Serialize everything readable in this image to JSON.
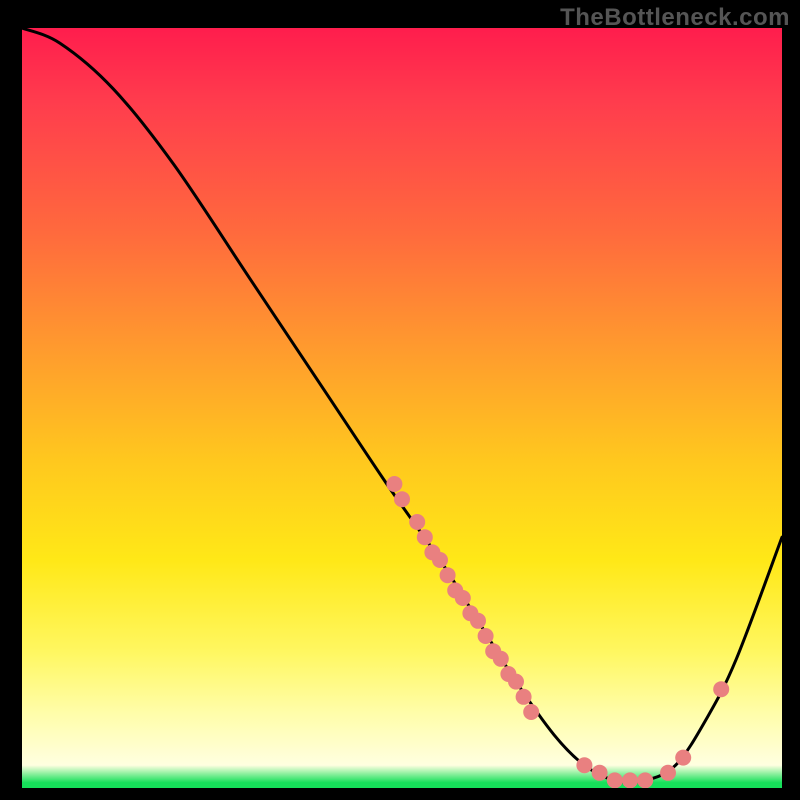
{
  "watermark": "TheBottleneck.com",
  "chart_data": {
    "type": "line",
    "title": "",
    "xlabel": "",
    "ylabel": "",
    "xlim": [
      0,
      100
    ],
    "ylim": [
      0,
      100
    ],
    "series": [
      {
        "name": "curve",
        "points": [
          {
            "x": 0,
            "y": 100
          },
          {
            "x": 5,
            "y": 98
          },
          {
            "x": 12,
            "y": 92
          },
          {
            "x": 20,
            "y": 82
          },
          {
            "x": 30,
            "y": 67
          },
          {
            "x": 40,
            "y": 52
          },
          {
            "x": 48,
            "y": 40
          },
          {
            "x": 55,
            "y": 30
          },
          {
            "x": 60,
            "y": 22
          },
          {
            "x": 65,
            "y": 14
          },
          {
            "x": 70,
            "y": 7
          },
          {
            "x": 74,
            "y": 3
          },
          {
            "x": 78,
            "y": 1
          },
          {
            "x": 82,
            "y": 1
          },
          {
            "x": 86,
            "y": 3
          },
          {
            "x": 90,
            "y": 9
          },
          {
            "x": 94,
            "y": 17
          },
          {
            "x": 100,
            "y": 33
          }
        ]
      }
    ],
    "scatter": [
      {
        "x": 49,
        "y": 40
      },
      {
        "x": 50,
        "y": 38
      },
      {
        "x": 52,
        "y": 35
      },
      {
        "x": 53,
        "y": 33
      },
      {
        "x": 54,
        "y": 31
      },
      {
        "x": 55,
        "y": 30
      },
      {
        "x": 56,
        "y": 28
      },
      {
        "x": 57,
        "y": 26
      },
      {
        "x": 58,
        "y": 25
      },
      {
        "x": 59,
        "y": 23
      },
      {
        "x": 60,
        "y": 22
      },
      {
        "x": 61,
        "y": 20
      },
      {
        "x": 62,
        "y": 18
      },
      {
        "x": 63,
        "y": 17
      },
      {
        "x": 64,
        "y": 15
      },
      {
        "x": 65,
        "y": 14
      },
      {
        "x": 66,
        "y": 12
      },
      {
        "x": 67,
        "y": 10
      },
      {
        "x": 74,
        "y": 3
      },
      {
        "x": 76,
        "y": 2
      },
      {
        "x": 78,
        "y": 1
      },
      {
        "x": 80,
        "y": 1
      },
      {
        "x": 82,
        "y": 1
      },
      {
        "x": 85,
        "y": 2
      },
      {
        "x": 87,
        "y": 4
      },
      {
        "x": 92,
        "y": 13
      }
    ],
    "colors": {
      "curve": "#000000",
      "scatter": "#e98080",
      "gradient_top": "#ff1d4d",
      "gradient_mid": "#ffe817",
      "gradient_bottom": "#16e05a"
    }
  }
}
